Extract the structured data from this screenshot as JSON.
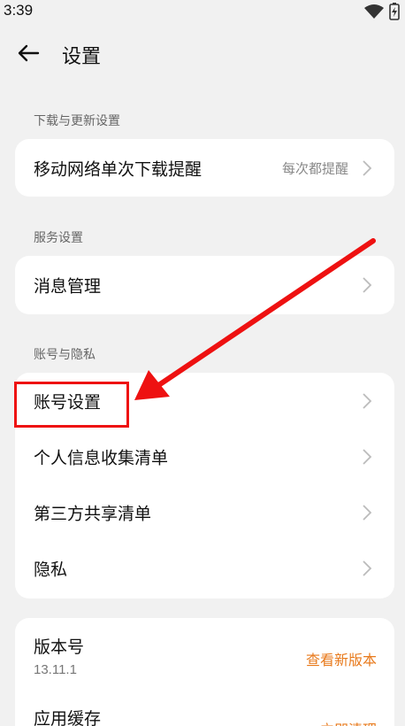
{
  "status_bar": {
    "time": "3:39"
  },
  "header": {
    "title": "设置"
  },
  "sections": {
    "download": {
      "label": "下载与更新设置",
      "items": [
        {
          "label": "移动网络单次下载提醒",
          "value": "每次都提醒"
        }
      ]
    },
    "service": {
      "label": "服务设置",
      "items": [
        {
          "label": "消息管理"
        }
      ]
    },
    "account": {
      "label": "账号与隐私",
      "items": [
        {
          "label": "账号设置"
        },
        {
          "label": "个人信息收集清单"
        },
        {
          "label": "第三方共享清单"
        },
        {
          "label": "隐私"
        }
      ]
    },
    "about": {
      "version_label": "版本号",
      "version_value": "13.11.1",
      "version_action": "查看新版本",
      "cache_label": "应用缓存",
      "cache_action": "立即清理"
    }
  },
  "colors": {
    "accent": "#e87a1c",
    "annotation": "#e11111",
    "background": "#f1f1f1"
  },
  "icons": {
    "back": "arrow-left-icon",
    "chevron": "chevron-right-icon",
    "wifi": "wifi-icon",
    "battery": "battery-charging-icon"
  }
}
